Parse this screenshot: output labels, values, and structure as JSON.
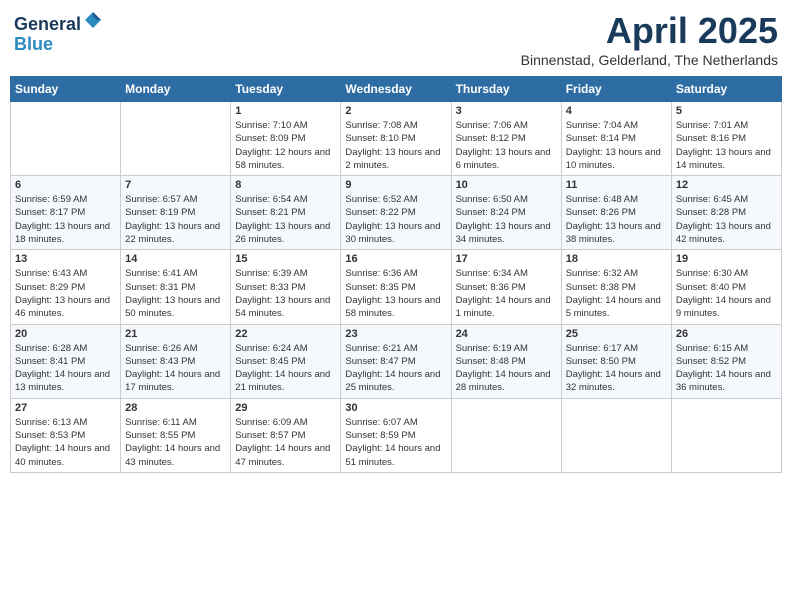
{
  "header": {
    "logo_line1": "General",
    "logo_line2": "Blue",
    "month_year": "April 2025",
    "location": "Binnenstad, Gelderland, The Netherlands"
  },
  "days_of_week": [
    "Sunday",
    "Monday",
    "Tuesday",
    "Wednesday",
    "Thursday",
    "Friday",
    "Saturday"
  ],
  "weeks": [
    [
      {
        "day": "",
        "info": ""
      },
      {
        "day": "",
        "info": ""
      },
      {
        "day": "1",
        "info": "Sunrise: 7:10 AM\nSunset: 8:09 PM\nDaylight: 12 hours and 58 minutes."
      },
      {
        "day": "2",
        "info": "Sunrise: 7:08 AM\nSunset: 8:10 PM\nDaylight: 13 hours and 2 minutes."
      },
      {
        "day": "3",
        "info": "Sunrise: 7:06 AM\nSunset: 8:12 PM\nDaylight: 13 hours and 6 minutes."
      },
      {
        "day": "4",
        "info": "Sunrise: 7:04 AM\nSunset: 8:14 PM\nDaylight: 13 hours and 10 minutes."
      },
      {
        "day": "5",
        "info": "Sunrise: 7:01 AM\nSunset: 8:16 PM\nDaylight: 13 hours and 14 minutes."
      }
    ],
    [
      {
        "day": "6",
        "info": "Sunrise: 6:59 AM\nSunset: 8:17 PM\nDaylight: 13 hours and 18 minutes."
      },
      {
        "day": "7",
        "info": "Sunrise: 6:57 AM\nSunset: 8:19 PM\nDaylight: 13 hours and 22 minutes."
      },
      {
        "day": "8",
        "info": "Sunrise: 6:54 AM\nSunset: 8:21 PM\nDaylight: 13 hours and 26 minutes."
      },
      {
        "day": "9",
        "info": "Sunrise: 6:52 AM\nSunset: 8:22 PM\nDaylight: 13 hours and 30 minutes."
      },
      {
        "day": "10",
        "info": "Sunrise: 6:50 AM\nSunset: 8:24 PM\nDaylight: 13 hours and 34 minutes."
      },
      {
        "day": "11",
        "info": "Sunrise: 6:48 AM\nSunset: 8:26 PM\nDaylight: 13 hours and 38 minutes."
      },
      {
        "day": "12",
        "info": "Sunrise: 6:45 AM\nSunset: 8:28 PM\nDaylight: 13 hours and 42 minutes."
      }
    ],
    [
      {
        "day": "13",
        "info": "Sunrise: 6:43 AM\nSunset: 8:29 PM\nDaylight: 13 hours and 46 minutes."
      },
      {
        "day": "14",
        "info": "Sunrise: 6:41 AM\nSunset: 8:31 PM\nDaylight: 13 hours and 50 minutes."
      },
      {
        "day": "15",
        "info": "Sunrise: 6:39 AM\nSunset: 8:33 PM\nDaylight: 13 hours and 54 minutes."
      },
      {
        "day": "16",
        "info": "Sunrise: 6:36 AM\nSunset: 8:35 PM\nDaylight: 13 hours and 58 minutes."
      },
      {
        "day": "17",
        "info": "Sunrise: 6:34 AM\nSunset: 8:36 PM\nDaylight: 14 hours and 1 minute."
      },
      {
        "day": "18",
        "info": "Sunrise: 6:32 AM\nSunset: 8:38 PM\nDaylight: 14 hours and 5 minutes."
      },
      {
        "day": "19",
        "info": "Sunrise: 6:30 AM\nSunset: 8:40 PM\nDaylight: 14 hours and 9 minutes."
      }
    ],
    [
      {
        "day": "20",
        "info": "Sunrise: 6:28 AM\nSunset: 8:41 PM\nDaylight: 14 hours and 13 minutes."
      },
      {
        "day": "21",
        "info": "Sunrise: 6:26 AM\nSunset: 8:43 PM\nDaylight: 14 hours and 17 minutes."
      },
      {
        "day": "22",
        "info": "Sunrise: 6:24 AM\nSunset: 8:45 PM\nDaylight: 14 hours and 21 minutes."
      },
      {
        "day": "23",
        "info": "Sunrise: 6:21 AM\nSunset: 8:47 PM\nDaylight: 14 hours and 25 minutes."
      },
      {
        "day": "24",
        "info": "Sunrise: 6:19 AM\nSunset: 8:48 PM\nDaylight: 14 hours and 28 minutes."
      },
      {
        "day": "25",
        "info": "Sunrise: 6:17 AM\nSunset: 8:50 PM\nDaylight: 14 hours and 32 minutes."
      },
      {
        "day": "26",
        "info": "Sunrise: 6:15 AM\nSunset: 8:52 PM\nDaylight: 14 hours and 36 minutes."
      }
    ],
    [
      {
        "day": "27",
        "info": "Sunrise: 6:13 AM\nSunset: 8:53 PM\nDaylight: 14 hours and 40 minutes."
      },
      {
        "day": "28",
        "info": "Sunrise: 6:11 AM\nSunset: 8:55 PM\nDaylight: 14 hours and 43 minutes."
      },
      {
        "day": "29",
        "info": "Sunrise: 6:09 AM\nSunset: 8:57 PM\nDaylight: 14 hours and 47 minutes."
      },
      {
        "day": "30",
        "info": "Sunrise: 6:07 AM\nSunset: 8:59 PM\nDaylight: 14 hours and 51 minutes."
      },
      {
        "day": "",
        "info": ""
      },
      {
        "day": "",
        "info": ""
      },
      {
        "day": "",
        "info": ""
      }
    ]
  ]
}
